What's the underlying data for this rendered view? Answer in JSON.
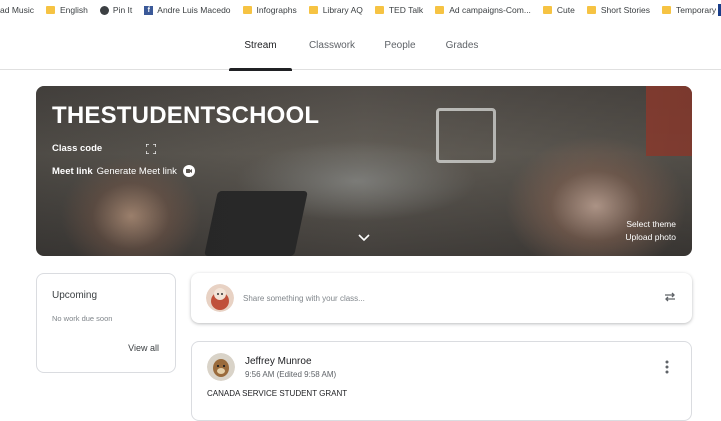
{
  "bookmarks": [
    {
      "label": "ad Music",
      "icon": "none"
    },
    {
      "label": "English",
      "icon": "folder-icon"
    },
    {
      "label": "Pin It",
      "icon": "pin-icon"
    },
    {
      "label": "Andre Luis Macedo",
      "icon": "facebook-icon"
    },
    {
      "label": "Infographs",
      "icon": "folder-icon"
    },
    {
      "label": "Library AQ",
      "icon": "folder-icon"
    },
    {
      "label": "TED Talk",
      "icon": "folder-icon"
    },
    {
      "label": "Ad campaigns-Com...",
      "icon": "folder-icon"
    },
    {
      "label": "Cute",
      "icon": "folder-icon"
    },
    {
      "label": "Short Stories",
      "icon": "folder-icon"
    },
    {
      "label": "Temporary",
      "icon": "folder-icon"
    }
  ],
  "nav": {
    "tabs": [
      "Stream",
      "Classwork",
      "People",
      "Grades"
    ],
    "active": "Stream"
  },
  "banner": {
    "class_name": "THESTUDENTSCHOOL",
    "class_code_label": "Class code",
    "meet_label": "Meet link",
    "meet_action": "Generate Meet link",
    "select_theme": "Select theme",
    "upload_photo": "Upload photo"
  },
  "upcoming": {
    "title": "Upcoming",
    "empty": "No work due soon",
    "view_all": "View all"
  },
  "share": {
    "placeholder": "Share something with your class..."
  },
  "post": {
    "author": "Jeffrey Munroe",
    "time": "9:56 AM (Edited 9:58 AM)",
    "body": "CANADA SERVICE STUDENT GRANT"
  },
  "colors": {
    "active_tab": "#202124",
    "muted_text": "#5f6368",
    "folder": "#f6c343",
    "facebook": "#3b5998"
  }
}
